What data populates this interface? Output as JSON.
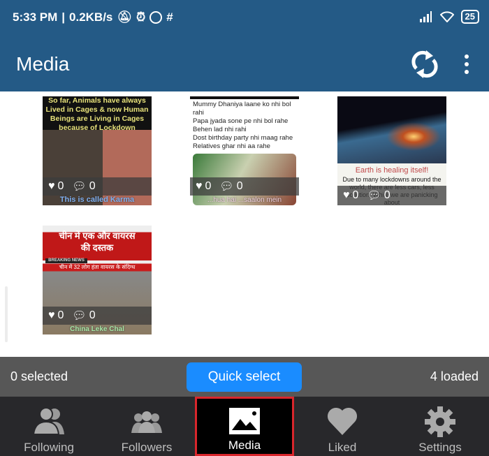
{
  "status_bar": {
    "time": "5:33 PM",
    "speed": "0.2KB/s",
    "battery": "25"
  },
  "app_bar": {
    "title": "Media",
    "icons": [
      "refresh-icon",
      "more-vert-icon"
    ]
  },
  "media": [
    {
      "caption": "So far, Animals have always Lived in Cages & now Human Beings are Living in Cages because of Lockdown",
      "footer": "This is called Karma",
      "likes": "0",
      "comments": "0"
    },
    {
      "caption": "Mummy Dhaniya laane ko nhi bol rahi\nPapa jyada sone pe nhi bol rahe\nBehen lad nhi rahi\nDost birthday party nhi maag rahe\nRelatives ghar nhi aa rahe",
      "footer": "...hua hai ...saalon mein",
      "likes": "0",
      "comments": "0"
    },
    {
      "caption": "Earth is healing itself!",
      "subcaption": "Due to many lockdowns around the world, there are less cars, less pollution. While we are panicking about",
      "likes": "0",
      "comments": "0"
    },
    {
      "caption": "चीन में एक और वायरस की दस्तक",
      "ticker": "चीन में 32 लोग हंता वायरस के संदिग्ध",
      "badge": "BREAKING NEWS",
      "footer": "China Leke Chal",
      "likes": "0",
      "comments": "0"
    }
  ],
  "selection": {
    "selected": "0 selected",
    "quick_select": "Quick select",
    "loaded": "4 loaded"
  },
  "nav": [
    {
      "label": "Following",
      "icon": "user-pair-icon"
    },
    {
      "label": "Followers",
      "icon": "users-group-icon"
    },
    {
      "label": "Media",
      "icon": "image-icon",
      "active": true
    },
    {
      "label": "Liked",
      "icon": "heart-icon"
    },
    {
      "label": "Settings",
      "icon": "gear-icon"
    }
  ],
  "colors": {
    "app_bar": "#245a86",
    "accent": "#1a8cff",
    "active_border": "#d9262c"
  }
}
